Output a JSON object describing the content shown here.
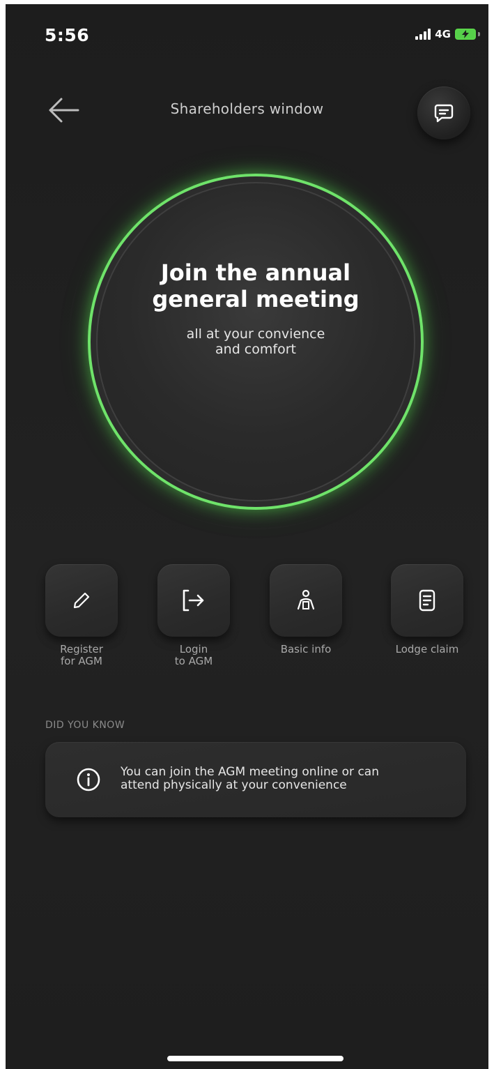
{
  "status_bar": {
    "time": "5:56",
    "network": "4G",
    "battery_color": "#56d04a"
  },
  "header": {
    "title": "Shareholders window",
    "back_icon": "arrow-left-icon",
    "chat_icon": "message-icon"
  },
  "hero": {
    "title_line1": "Join the annual",
    "title_line2": "general meeting",
    "subtitle_line1": "all at your convience",
    "subtitle_line2": "and comfort",
    "ring_color": "#6fe36a"
  },
  "actions": [
    {
      "icon": "pencil-icon",
      "label_line1": "Register",
      "label_line2": "for AGM"
    },
    {
      "icon": "login-icon",
      "label_line1": "Login",
      "label_line2": "to AGM"
    },
    {
      "icon": "person-icon",
      "label_line1": "Basic info",
      "label_line2": ""
    },
    {
      "icon": "document-icon",
      "label_line1": "Lodge claim",
      "label_line2": ""
    }
  ],
  "did_you_know": {
    "heading": "DID YOU KNOW",
    "icon": "info-icon",
    "text_line1": "You can join the AGM meeting online or can",
    "text_line2": "attend physically at your convenience"
  }
}
